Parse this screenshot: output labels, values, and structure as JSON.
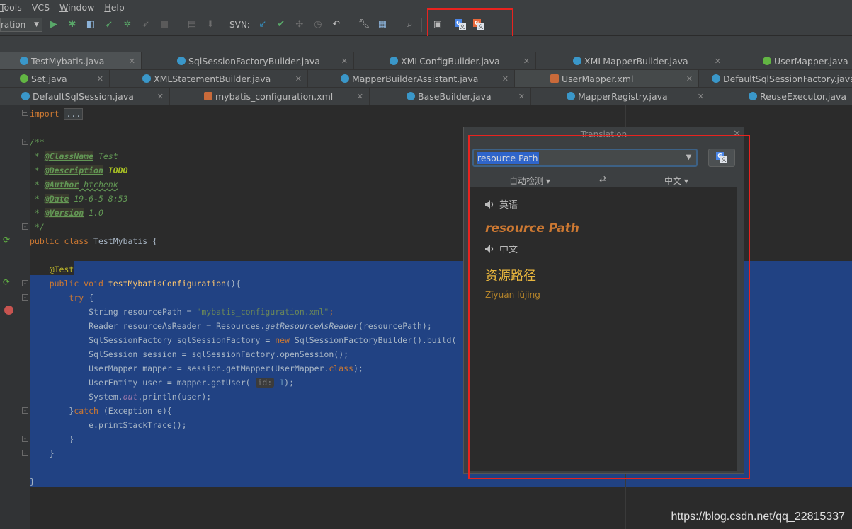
{
  "menu": [
    {
      "label": "Tools",
      "ul": "T",
      "rest": "ools"
    },
    {
      "label": "VCS",
      "ul": "",
      "rest": "VCS"
    },
    {
      "label": "Window",
      "ul": "W",
      "rest": "indow"
    },
    {
      "label": "Help",
      "ul": "H",
      "rest": "elp"
    }
  ],
  "toolbar": {
    "run_config": "ration",
    "svn_label": "SVN:"
  },
  "tabs": {
    "row1": [
      "TestMybatis.java",
      "SqlSessionFactoryBuilder.java",
      "XMLConfigBuilder.java",
      "XMLMapperBuilder.java",
      "UserMapper.java"
    ],
    "row2": [
      "Set.java",
      "XMLStatementBuilder.java",
      "MapperBuilderAssistant.java",
      "UserMapper.xml",
      "DefaultSqlSessionFactory.java"
    ],
    "row3": [
      "DefaultSqlSession.java",
      "mybatis_configuration.xml",
      "BaseBuilder.java",
      "MapperRegistry.java",
      "ReuseExecutor.java"
    ]
  },
  "code": {
    "import_kw": "import",
    "import_collapsed": "...",
    "javadoc_open": "/**",
    "classname_tag": "@ClassName",
    "classname_val": " Test",
    "desc_tag": "@Description",
    "desc_val": " TODO",
    "author_tag": "@Author",
    "author_val": " htchenk",
    "date_tag": "@Date",
    "date_val": " 19-6-5 8:53",
    "version_tag": "@Version",
    "version_val": " 1.0",
    "javadoc_close": "*/",
    "class_decl_kw": "public class ",
    "class_decl_name": "TestMybatis {",
    "annotation": "@Test",
    "method_kw": "public void ",
    "method_name": "testMybatisConfiguration",
    "method_rest": "(){",
    "try_kw": "try",
    "try_rest": " {",
    "l1_a": "String resourcePath = ",
    "l1_str": "\"mybatis_configuration.xml\"",
    "l1_end": ";",
    "l2_a": "Reader resourceAsReader = Resources.",
    "l2_m": "getResourceAsReader",
    "l2_end": "(resourcePath);",
    "l3_a": "SqlSessionFactory sqlSessionFactory = ",
    "l3_new": "new",
    "l3_end": " SqlSessionFactoryBuilder().build(",
    "l4": "SqlSession session = sqlSessionFactory.openSession();",
    "l5_a": "UserMapper mapper = session.getMapper(UserMapper.",
    "l5_kw": "class",
    "l5_end": ");",
    "l6_a": "UserEntity user = mapper.getUser( ",
    "l6_hint": "id:",
    "l6_num": " 1",
    "l6_end": ");",
    "l7_a": "System.",
    "l7_f": "out",
    "l7_end": ".println(user);",
    "catch_a": "}",
    "catch_kw": "catch",
    "catch_end": " (Exception e){",
    "l8": "e.printStackTrace();",
    "brace": "}"
  },
  "translation": {
    "title": "Translation",
    "close": "✕",
    "input_value": "resource Path",
    "source_lang": "自动检测 ▾",
    "swap": "⇄",
    "target_lang": "中文 ▾",
    "src_lang_label": "英语",
    "src_text": "resource Path",
    "tgt_lang_label": "中文",
    "tgt_text": "资源路径",
    "pinyin": "Zīyuán lùjìng"
  },
  "watermark": "https://blog.csdn.net/qq_22815337",
  "colors": {
    "highlight_box": "#e8231f",
    "selection": "#214283"
  }
}
